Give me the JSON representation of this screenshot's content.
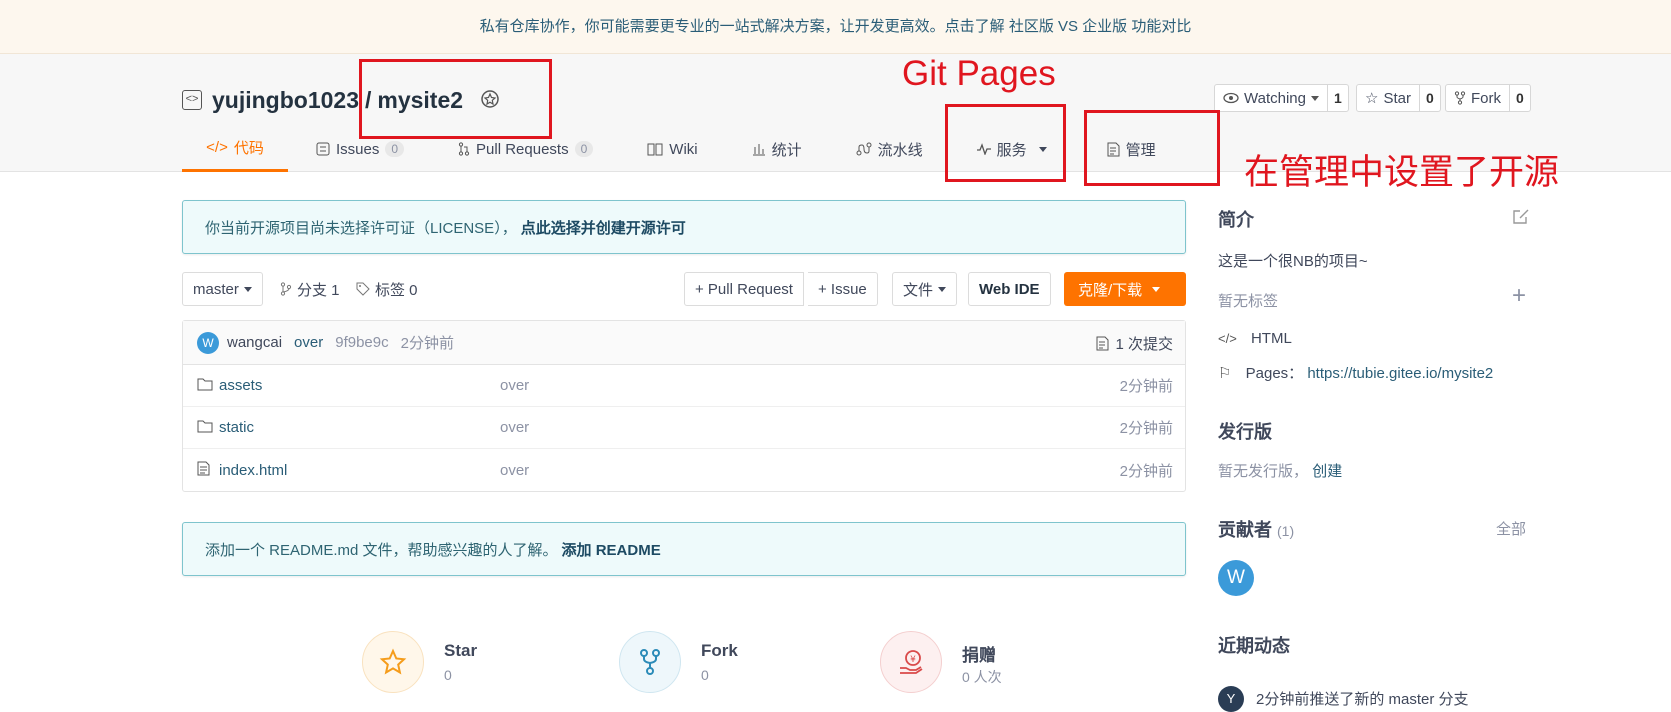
{
  "banner": {
    "text": "私有仓库协作，你可能需要更专业的一站式解决方案，让开发更高效。点击了解",
    "link": "社区版 VS 企业版 功能对比"
  },
  "repo": {
    "owner": "yujingbo1023",
    "separator": "/",
    "name": "mysite2"
  },
  "actions": {
    "watch": {
      "label": "Watching",
      "count": "1"
    },
    "star": {
      "label": "Star",
      "count": "0"
    },
    "fork": {
      "label": "Fork",
      "count": "0"
    }
  },
  "tabs": {
    "code": "代码",
    "issues": {
      "label": "Issues",
      "count": "0"
    },
    "pulls": {
      "label": "Pull Requests",
      "count": "0"
    },
    "wiki": "Wiki",
    "stats": "统计",
    "pipeline": "流水线",
    "services": "服务",
    "manage": "管理"
  },
  "annotations": {
    "git_pages": "Git Pages",
    "manage_note": "在管理中设置了开源"
  },
  "license_notice": {
    "text": "你当前开源项目尚未选择许可证（LICENSE），",
    "link": "点此选择并创建开源许可"
  },
  "toolbar": {
    "branch": "master",
    "branches": "分支 1",
    "tags": "标签 0",
    "pull_request": "+ Pull Request",
    "issue": "+ Issue",
    "file": "文件",
    "web_ide": "Web IDE",
    "clone": "克隆/下载"
  },
  "commit": {
    "avatar_letter": "W",
    "author": "wangcai",
    "message": "over",
    "sha": "9f9be9c",
    "time": "2分钟前",
    "count": "1 次提交"
  },
  "files": [
    {
      "name": "assets",
      "message": "over",
      "time": "2分钟前",
      "icon": "folder-icon"
    },
    {
      "name": "static",
      "message": "over",
      "time": "2分钟前",
      "icon": "folder-icon"
    },
    {
      "name": "index.html",
      "message": "over",
      "time": "2分钟前",
      "icon": "file-icon"
    }
  ],
  "readme_notice": {
    "text": "添加一个 README.md 文件，帮助感兴趣的人了解。",
    "link": "添加 README"
  },
  "stats": {
    "star": {
      "label": "Star",
      "value": "0"
    },
    "fork": {
      "label": "Fork",
      "value": "0"
    },
    "donate": {
      "label": "捐赠",
      "value": "0 人次"
    }
  },
  "sidebar": {
    "intro_title": "简介",
    "description": "这是一个很NB的项目~",
    "no_tags": "暂无标签",
    "language": "HTML",
    "pages_label": "Pages：",
    "pages_url": "https://tubie.gitee.io/mysite2",
    "releases_title": "发行版",
    "no_releases": "暂无发行版，",
    "create_release": "创建",
    "contributors_title": "贡献者",
    "contributors_count": "(1)",
    "all": "全部",
    "contributor_letter": "W",
    "activity_title": "近期动态",
    "activity_avatar_letter": "Y",
    "activity_first": "2分钟前推送了新的 master 分支"
  }
}
